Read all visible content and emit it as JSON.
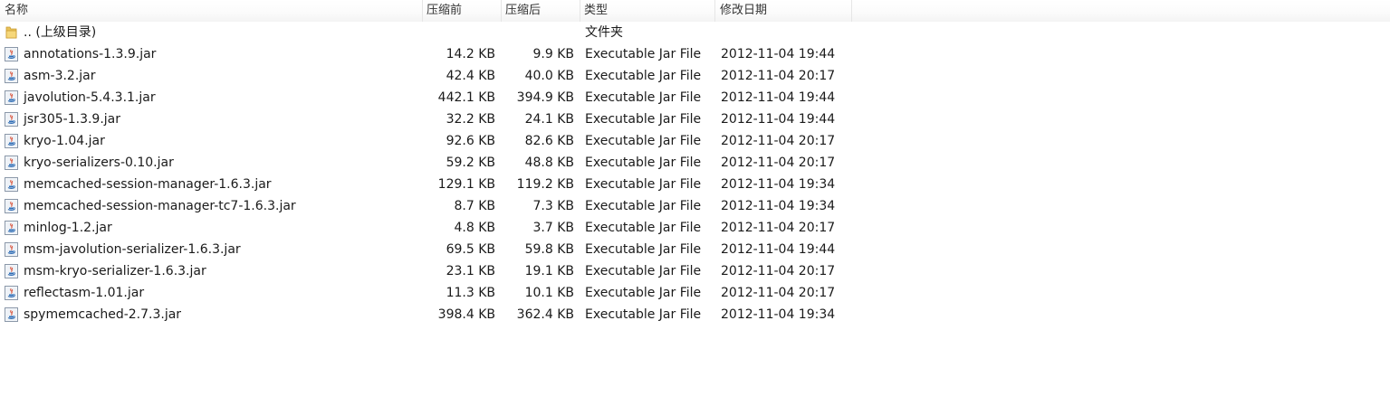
{
  "header": {
    "name": "名称",
    "original_size": "压缩前",
    "compressed_size": "压缩后",
    "type": "类型",
    "modified": "修改日期"
  },
  "parent_row": {
    "name": ".. (上级目录)",
    "type": "文件夹",
    "icon": "folder-icon"
  },
  "files": [
    {
      "name": "annotations-1.3.9.jar",
      "original": "14.2 KB",
      "compressed": "9.9 KB",
      "type": "Executable Jar File",
      "modified": "2012-11-04 19:44",
      "icon": "jar-icon"
    },
    {
      "name": "asm-3.2.jar",
      "original": "42.4 KB",
      "compressed": "40.0 KB",
      "type": "Executable Jar File",
      "modified": "2012-11-04 20:17",
      "icon": "jar-icon"
    },
    {
      "name": "javolution-5.4.3.1.jar",
      "original": "442.1 KB",
      "compressed": "394.9 KB",
      "type": "Executable Jar File",
      "modified": "2012-11-04 19:44",
      "icon": "jar-icon"
    },
    {
      "name": "jsr305-1.3.9.jar",
      "original": "32.2 KB",
      "compressed": "24.1 KB",
      "type": "Executable Jar File",
      "modified": "2012-11-04 19:44",
      "icon": "jar-icon"
    },
    {
      "name": "kryo-1.04.jar",
      "original": "92.6 KB",
      "compressed": "82.6 KB",
      "type": "Executable Jar File",
      "modified": "2012-11-04 20:17",
      "icon": "jar-icon"
    },
    {
      "name": "kryo-serializers-0.10.jar",
      "original": "59.2 KB",
      "compressed": "48.8 KB",
      "type": "Executable Jar File",
      "modified": "2012-11-04 20:17",
      "icon": "jar-icon"
    },
    {
      "name": "memcached-session-manager-1.6.3.jar",
      "original": "129.1 KB",
      "compressed": "119.2 KB",
      "type": "Executable Jar File",
      "modified": "2012-11-04 19:34",
      "icon": "jar-icon"
    },
    {
      "name": "memcached-session-manager-tc7-1.6.3.jar",
      "original": "8.7 KB",
      "compressed": "7.3 KB",
      "type": "Executable Jar File",
      "modified": "2012-11-04 19:34",
      "icon": "jar-icon"
    },
    {
      "name": "minlog-1.2.jar",
      "original": "4.8 KB",
      "compressed": "3.7 KB",
      "type": "Executable Jar File",
      "modified": "2012-11-04 20:17",
      "icon": "jar-icon"
    },
    {
      "name": "msm-javolution-serializer-1.6.3.jar",
      "original": "69.5 KB",
      "compressed": "59.8 KB",
      "type": "Executable Jar File",
      "modified": "2012-11-04 19:44",
      "icon": "jar-icon"
    },
    {
      "name": "msm-kryo-serializer-1.6.3.jar",
      "original": "23.1 KB",
      "compressed": "19.1 KB",
      "type": "Executable Jar File",
      "modified": "2012-11-04 20:17",
      "icon": "jar-icon"
    },
    {
      "name": "reflectasm-1.01.jar",
      "original": "11.3 KB",
      "compressed": "10.1 KB",
      "type": "Executable Jar File",
      "modified": "2012-11-04 20:17",
      "icon": "jar-icon"
    },
    {
      "name": "spymemcached-2.7.3.jar",
      "original": "398.4 KB",
      "compressed": "362.4 KB",
      "type": "Executable Jar File",
      "modified": "2012-11-04 19:34",
      "icon": "jar-icon"
    }
  ]
}
